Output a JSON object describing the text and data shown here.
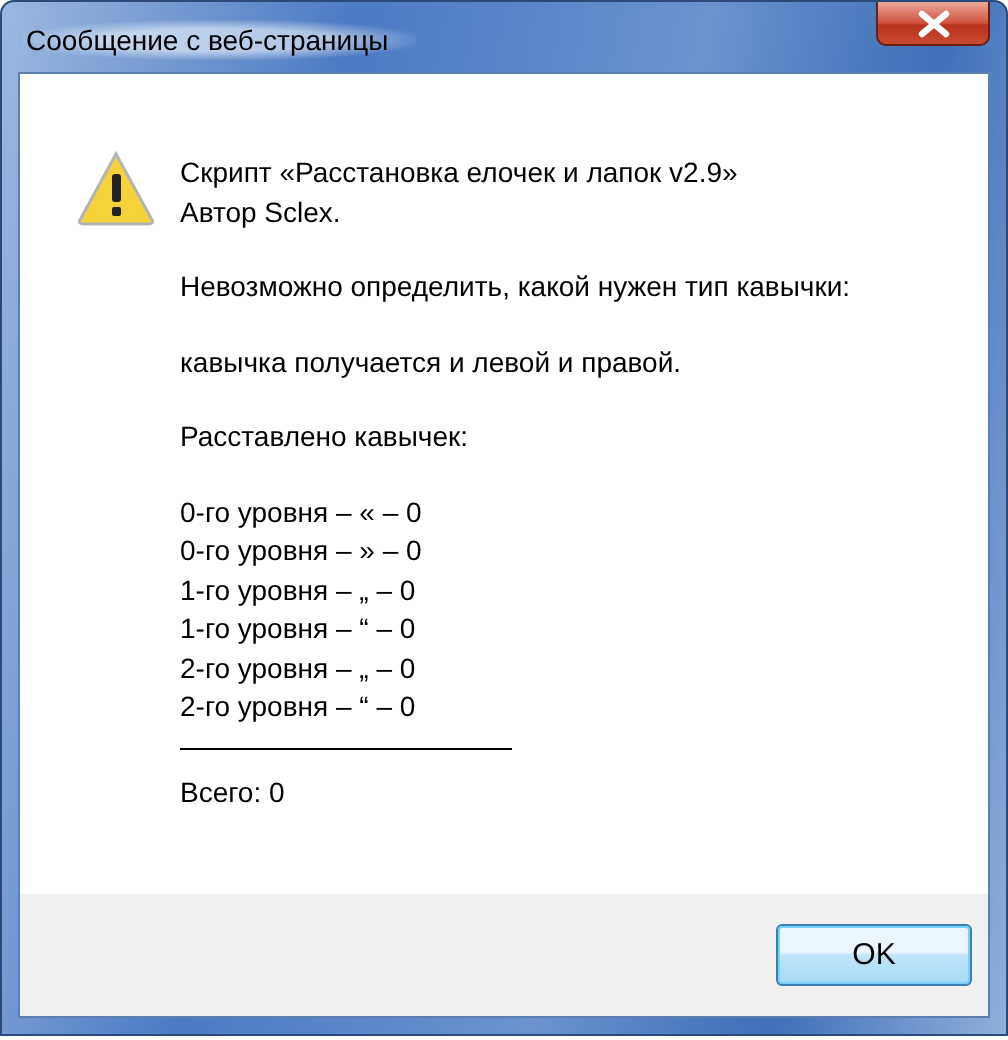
{
  "window": {
    "title": "Сообщение с веб-страницы"
  },
  "message": [
    [
      "Скрипт «Расстановка елочек и лапок v2.9»",
      "Автор Sclex."
    ],
    [
      "Невозможно определить, какой нужен тип кавычки:"
    ],
    [
      "кавычка получается и левой и правой."
    ],
    [
      "Расставлено кавычек:"
    ],
    [
      "0-го уровня – « – 0",
      "0-го уровня – » – 0",
      "1-го уровня – „ – 0",
      "1-го уровня – “ – 0",
      "2-го уровня – „ – 0",
      "2-го уровня – “ – 0"
    ]
  ],
  "total": "Всего: 0",
  "buttons": [
    "OK"
  ]
}
